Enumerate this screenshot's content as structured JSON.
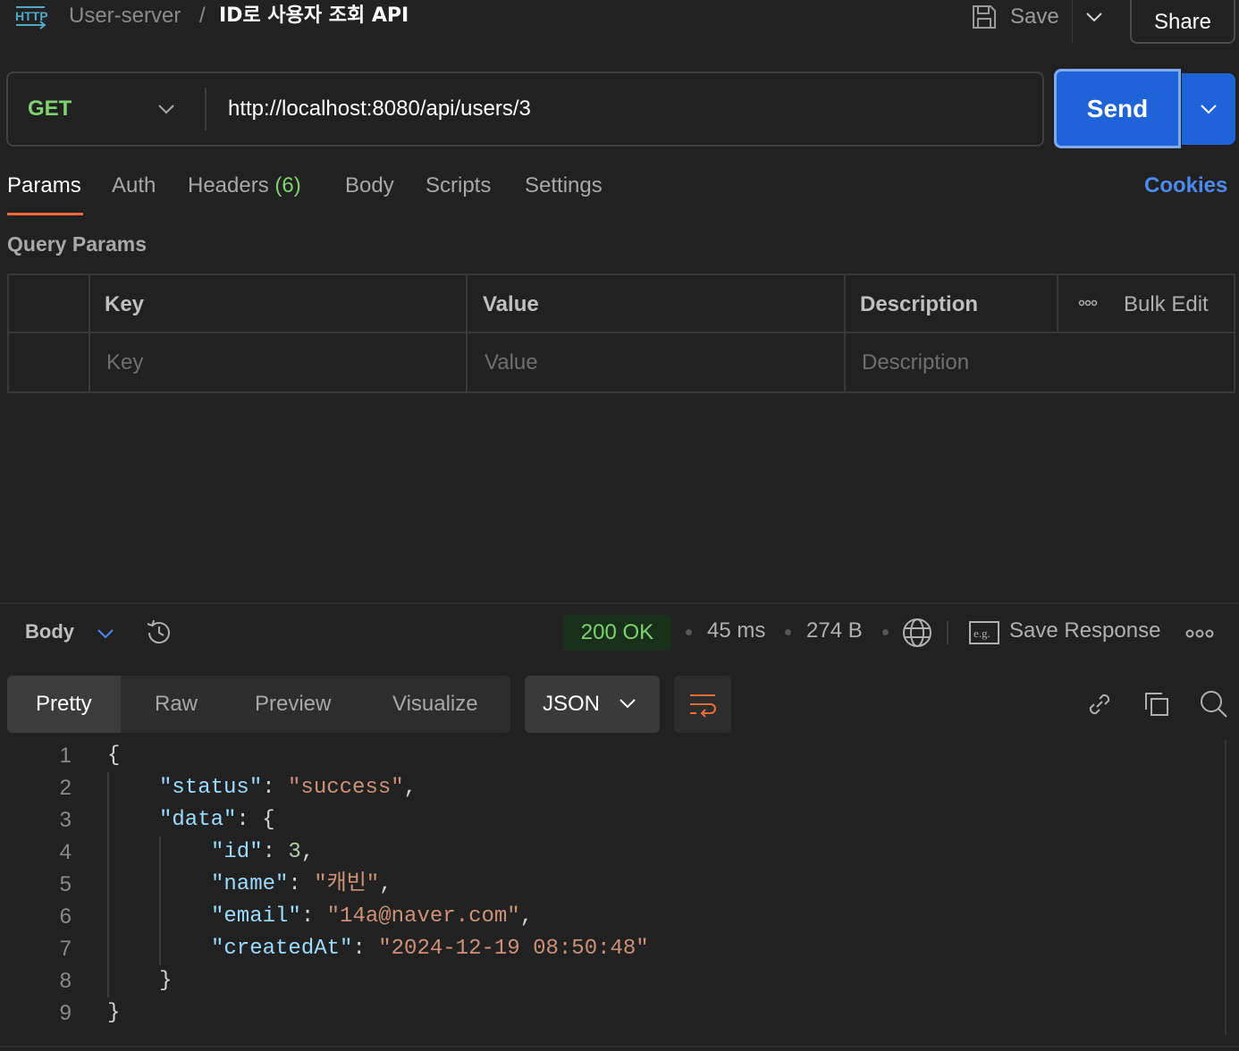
{
  "header": {
    "collection": "User-server",
    "separator": "/",
    "request_title": "ID로 사용자 조회 API",
    "save_label": "Save",
    "share_label": "Share"
  },
  "request": {
    "method": "GET",
    "url": "http://localhost:8080/api/users/3",
    "send_label": "Send"
  },
  "tabs": {
    "params": "Params",
    "auth": "Auth",
    "headers": "Headers",
    "headers_count": "(6)",
    "body": "Body",
    "scripts": "Scripts",
    "settings": "Settings",
    "cookies": "Cookies"
  },
  "query_params": {
    "section_label": "Query Params",
    "columns": {
      "key": "Key",
      "value": "Value",
      "description": "Description"
    },
    "bulk_edit": "Bulk Edit",
    "placeholders": {
      "key": "Key",
      "value": "Value",
      "description": "Description"
    }
  },
  "response": {
    "body_label": "Body",
    "status": "200 OK",
    "time": "45 ms",
    "size": "274 B",
    "save_response": "Save Response",
    "view_modes": [
      "Pretty",
      "Raw",
      "Preview",
      "Visualize"
    ],
    "format": "JSON",
    "lines": [
      {
        "num": "1",
        "parts": [
          [
            "p",
            "{"
          ]
        ]
      },
      {
        "num": "2",
        "parts": [
          [
            "k",
            "\"status\""
          ],
          [
            "p",
            ": "
          ],
          [
            "s",
            "\"success\""
          ],
          [
            "p",
            ","
          ]
        ]
      },
      {
        "num": "3",
        "parts": [
          [
            "k",
            "\"data\""
          ],
          [
            "p",
            ": {"
          ]
        ]
      },
      {
        "num": "4",
        "parts": [
          [
            "k",
            "\"id\""
          ],
          [
            "p",
            ": "
          ],
          [
            "n",
            "3"
          ],
          [
            "p",
            ","
          ]
        ]
      },
      {
        "num": "5",
        "parts": [
          [
            "k",
            "\"name\""
          ],
          [
            "p",
            ": "
          ],
          [
            "s",
            "\"캐빈\""
          ],
          [
            "p",
            ","
          ]
        ]
      },
      {
        "num": "6",
        "parts": [
          [
            "k",
            "\"email\""
          ],
          [
            "p",
            ": "
          ],
          [
            "s",
            "\"14a@naver.com\""
          ],
          [
            "p",
            ","
          ]
        ]
      },
      {
        "num": "7",
        "parts": [
          [
            "k",
            "\"createdAt\""
          ],
          [
            "p",
            ": "
          ],
          [
            "s",
            "\"2024-12-19 08:50:48\""
          ]
        ]
      },
      {
        "num": "8",
        "parts": [
          [
            "p",
            "}"
          ]
        ]
      },
      {
        "num": "9",
        "parts": [
          [
            "p",
            "}"
          ]
        ]
      }
    ]
  },
  "colors": {
    "method_get": "#7ed36e",
    "send_button": "#1f63d8",
    "active_tab_underline": "#f06a3a",
    "cookies_link": "#4d8af0",
    "status_ok": "#7ed36e"
  },
  "icons": [
    "http-icon",
    "save-icon",
    "chevron-down-icon",
    "history-icon",
    "globe-icon",
    "example-icon",
    "more-icon",
    "wrap-icon",
    "link-icon",
    "copy-icon",
    "search-icon"
  ]
}
